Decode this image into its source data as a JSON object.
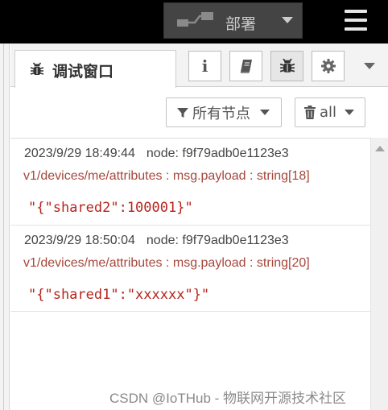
{
  "header": {
    "deploy_label": "部署",
    "menu_icon": "hamburger-menu-icon"
  },
  "sidebar_tabs": {
    "active_tab_label": "调试窗口",
    "active_tab_icon": "bug-icon",
    "buttons": [
      {
        "name": "info",
        "glyph": "i",
        "icon": "info-icon"
      },
      {
        "name": "help",
        "icon": "book-icon"
      },
      {
        "name": "debug",
        "icon": "bug-icon",
        "selected": true
      },
      {
        "name": "config",
        "icon": "gear-icon"
      }
    ]
  },
  "filters": {
    "node_filter_label": "所有节点",
    "clear_label": "all",
    "node_filter_icon": "filter-icon",
    "clear_icon": "trash-icon"
  },
  "messages": [
    {
      "timestamp": "2023/9/29 18:49:44",
      "node": "node: f9f79adb0e1123e3",
      "topic": "v1/devices/me/attributes : msg.payload : string[18]",
      "payload": "\"{\"shared2\":100001}\""
    },
    {
      "timestamp": "2023/9/29 18:50:04",
      "node": "node: f9f79adb0e1123e3",
      "topic": "v1/devices/me/attributes : msg.payload : string[20]",
      "payload": "\"{\"shared1\":\"xxxxxx\"}\""
    }
  ],
  "watermark": "CSDN @IoTHub - 物联网开源技术社区",
  "colors": {
    "topbar": "#000000",
    "deploy_bg": "#444444",
    "topic": "#a6473b",
    "payload": "#b7241c"
  }
}
